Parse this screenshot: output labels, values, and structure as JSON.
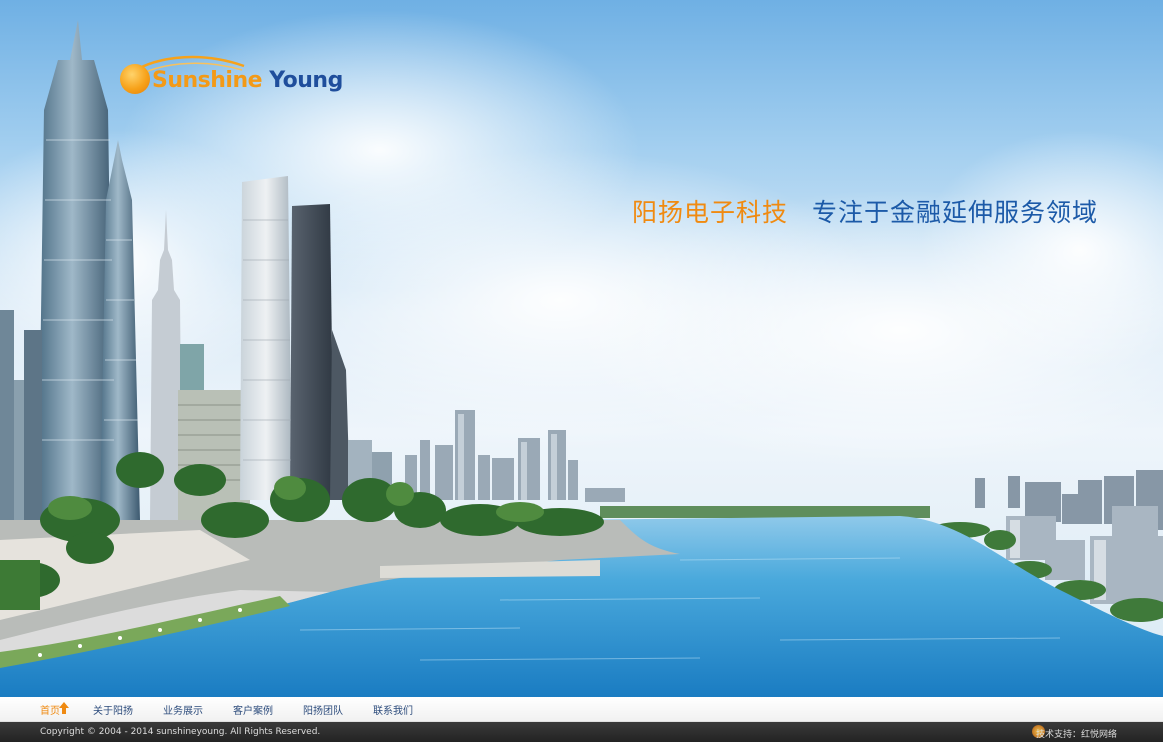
{
  "brand": {
    "word1": "Sunshine",
    "word2": "Young"
  },
  "slogan": {
    "company": "阳扬电子科技",
    "tagline": "专注于金融延伸服务领域"
  },
  "nav": {
    "items": [
      {
        "label": "首页",
        "active": true
      },
      {
        "label": "关于阳扬"
      },
      {
        "label": "业务展示"
      },
      {
        "label": "客户案例"
      },
      {
        "label": "阳扬团队"
      },
      {
        "label": "联系我们"
      }
    ]
  },
  "footer": {
    "copyright": "Copyright © 2004 - 2014 sunshineyoung. All Rights Reserved.",
    "support": "技术支持：红悦网络"
  },
  "colors": {
    "brand_orange": "#f39a17",
    "brand_blue": "#1f4e9c",
    "water": "#3c9fd8",
    "footer_bg": "#2b2b2b"
  }
}
